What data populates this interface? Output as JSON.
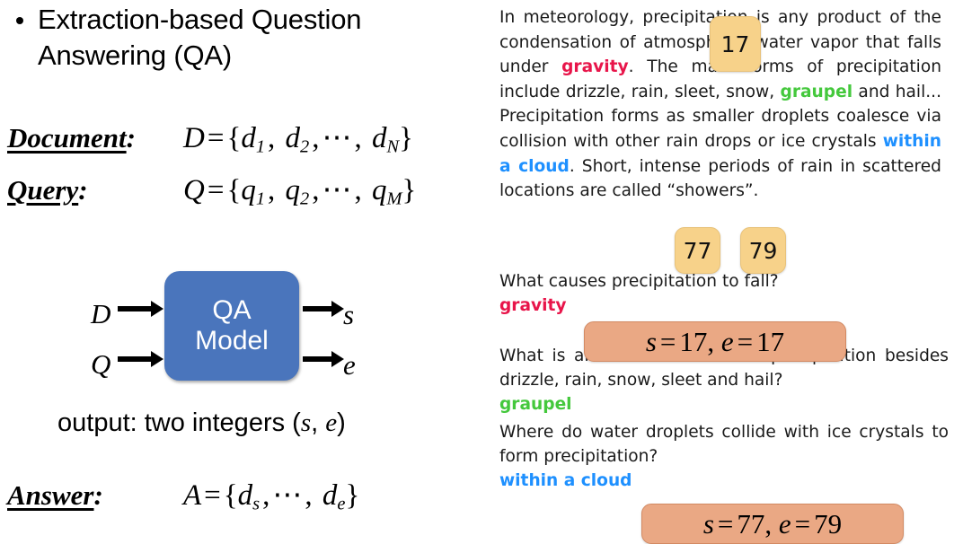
{
  "left": {
    "bullet": {
      "text": "Extraction-based Question Answering (QA)",
      "marker": "bullet-dot"
    },
    "definitions": [
      {
        "label": "Document",
        "label_suffix": ":",
        "math_plain": "D = {d_1, d_2, ⋯, d_N}",
        "var": "D",
        "eq": "=",
        "open": "{",
        "t1": "d",
        "t1sub": "1",
        "t2": "d",
        "t2sub": "2",
        "dots": "⋯",
        "t3": "d",
        "t3sub": "N",
        "close": "}"
      },
      {
        "label": "Query",
        "label_suffix": ":",
        "math_plain": "Q = {q_1, q_2, ⋯, q_M}",
        "var": "Q",
        "eq": "=",
        "open": "{",
        "t1": "q",
        "t1sub": "1",
        "t2": "q",
        "t2sub": "2",
        "dots": "⋯",
        "t3": "q",
        "t3sub": "M",
        "close": "}"
      },
      {
        "label": "Answer",
        "label_suffix": ":",
        "math_plain": "A = {d_s, ⋯, d_e}",
        "var": "A",
        "eq": "=",
        "open": "{",
        "t1": "d",
        "t1sub": "s",
        "dots": "⋯",
        "t3": "d",
        "t3sub": "e",
        "close": "}"
      }
    ],
    "diagram": {
      "box_label_line1": "QA",
      "box_label_line2": "Model",
      "box_color": "#4a75bc",
      "input_top": "D",
      "input_bottom": "Q",
      "output_top": "s",
      "output_bottom": "e",
      "arrow_color": "#000000"
    },
    "output_note": {
      "prefix": "output: two integers (",
      "var1": "s",
      "comma": ", ",
      "var2": "e",
      "suffix": ")"
    }
  },
  "right": {
    "passage": {
      "p1": "In meteorology, precipitation is any product of the condensation of atmospheric water vapor that falls under ",
      "hl1": "gravity",
      "p2": ". The main forms of precipitation include drizzle, rain, sleet, snow, ",
      "hl2": "graupel",
      "p3": " and hail... Precipitation forms as smaller droplets coalesce via collision with other rain drops or ice crystals ",
      "hl3": "within a cloud",
      "p4": ". Short, intense periods of rain in scattered locations are called “showers”.",
      "highlight_colors": {
        "gravity": "#e8154a",
        "graupel": "#44c83c",
        "within_a_cloud": "#1e90ff"
      }
    },
    "token_badges": [
      {
        "label": "17",
        "color": "#f7d28a"
      },
      {
        "label": "77",
        "color": "#f7d28a"
      },
      {
        "label": "79",
        "color": "#f7d28a"
      }
    ],
    "qa_pairs": [
      {
        "question": "What causes precipitation to fall?",
        "answer": "gravity",
        "answer_color": "#e8154a",
        "span": {
          "s_label": "s",
          "s_eq": "=",
          "s_val": "17",
          "sep": ",",
          "e_label": "e",
          "e_eq": "=",
          "e_val": "17"
        },
        "span_color": "#eaa884"
      },
      {
        "question": "What is another main form of precipitation besides drizzle, rain, snow, sleet and hail?",
        "answer": "graupel",
        "answer_color": "#44c83c",
        "span": null
      },
      {
        "question": "Where do water droplets collide with ice crystals to form precipitation?",
        "answer": "within a cloud",
        "answer_color": "#1e90ff",
        "span": {
          "s_label": "s",
          "s_eq": "=",
          "s_val": "77",
          "sep": ",",
          "e_label": "e",
          "e_eq": "=",
          "e_val": "79"
        },
        "span_color": "#eaa884"
      }
    ]
  }
}
